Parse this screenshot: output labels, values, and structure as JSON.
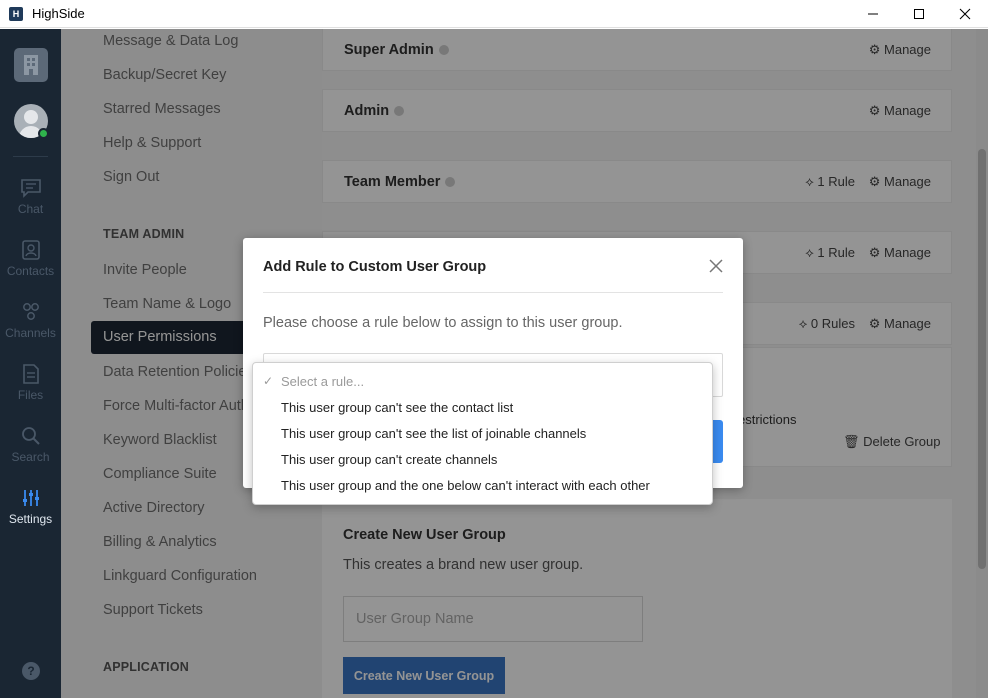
{
  "window": {
    "title": "HighSide",
    "app_icon_glyph": "H"
  },
  "rail": {
    "items": [
      {
        "label": "Chat",
        "icon": "chat-icon"
      },
      {
        "label": "Contacts",
        "icon": "contacts-icon"
      },
      {
        "label": "Channels",
        "icon": "channels-icon"
      },
      {
        "label": "Files",
        "icon": "files-icon"
      },
      {
        "label": "Search",
        "icon": "search-icon"
      },
      {
        "label": "Settings",
        "icon": "settings-icon",
        "active": true
      }
    ],
    "help_glyph": "?"
  },
  "settings_nav": {
    "top_items": [
      "Message & Data Log",
      "Backup/Secret Key",
      "Starred Messages",
      "Help & Support",
      "Sign Out"
    ],
    "team_admin_heading": "TEAM ADMIN",
    "team_admin_items": [
      "Invite People",
      "Team Name & Logo",
      "User Permissions",
      "Data Retention Policies",
      "Force Multi-factor Auth",
      "Keyword Blacklist",
      "Compliance Suite",
      "Active Directory",
      "Billing & Analytics",
      "Linkguard Configuration",
      "Support Tickets"
    ],
    "active_item": "User Permissions",
    "application_heading": "APPLICATION"
  },
  "groups": [
    {
      "name": "Super Admin",
      "rules": "",
      "manage": "Manage"
    },
    {
      "name": "Admin",
      "rules": "",
      "manage": "Manage"
    },
    {
      "name": "Team Member",
      "rules": "1 Rule",
      "manage": "Manage"
    },
    {
      "name": "",
      "rules": "1 Rule",
      "manage": "Manage"
    },
    {
      "name": "",
      "rules": "0 Rules",
      "manage": "Manage"
    }
  ],
  "custom_group": {
    "restrictions_fragment": "estrictions",
    "delete_label": "Delete Group"
  },
  "create_group": {
    "title": "Create New User Group",
    "description": "This creates a brand new user group.",
    "input_placeholder": "User Group Name",
    "button_label": "Create New User Group"
  },
  "modal": {
    "title": "Add Rule to Custom User Group",
    "description": "Please choose a rule below to assign to this user group."
  },
  "rule_dropdown": {
    "placeholder": "Select a rule...",
    "selected": "Select a rule...",
    "options": [
      "This user group can't see the contact list",
      "This user group can't see the list of joinable channels",
      "This user group can't create channels",
      "This user group and the one below can't interact with each other"
    ]
  }
}
